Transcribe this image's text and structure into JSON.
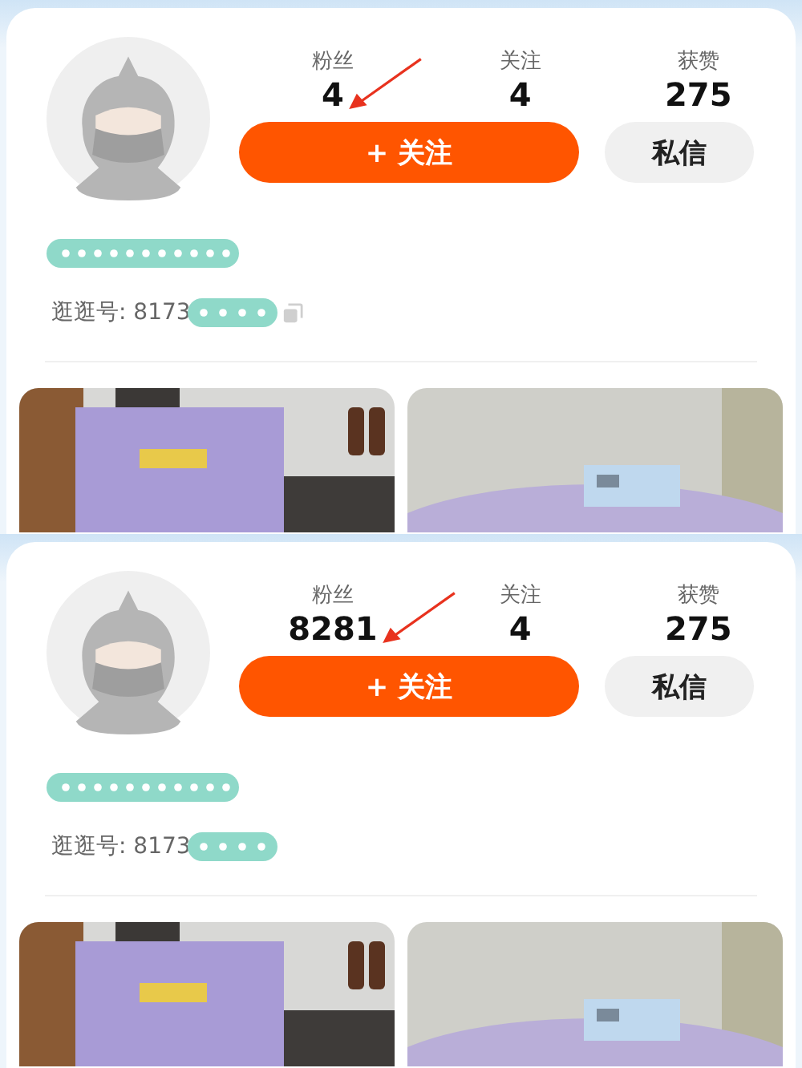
{
  "panels": [
    {
      "stats": [
        {
          "label": "粉丝",
          "value": "4"
        },
        {
          "label": "关注",
          "value": "4"
        },
        {
          "label": "获赞",
          "value": "275"
        }
      ],
      "follow_button": "+ 关注",
      "message_button": "私信",
      "id_text": "逛逛号: 8173",
      "copy_icon_visible": true
    },
    {
      "stats": [
        {
          "label": "粉丝",
          "value": "8281"
        },
        {
          "label": "关注",
          "value": "4"
        },
        {
          "label": "获赞",
          "value": "275"
        }
      ],
      "follow_button": "+ 关注",
      "message_button": "私信",
      "id_text": "逛逛号: 8173",
      "copy_icon_visible": false
    }
  ]
}
